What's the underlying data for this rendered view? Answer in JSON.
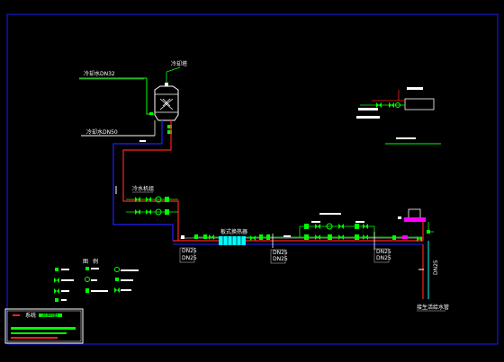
{
  "labels": {
    "top_left_pipe": "冷却水DN32",
    "mid_left_pipe": "冷却水DN50",
    "tower_top": "冷却塔",
    "valve_group": "冷水机组",
    "heat_exchanger": "板式换热器",
    "tag_a1": "DN25",
    "tag_a2": "DN25",
    "tag_b1": "DN25",
    "tag_b2": "DN25",
    "tag_c1": "DN25",
    "tag_c2": "DN25",
    "right_vertical": "DN25",
    "bottom_right": "接生活给水管",
    "legend_header_a": "图",
    "legend_header_b": "例",
    "title_main": "系统",
    "title_sub": "流程图"
  },
  "colors": {
    "background": "#000000",
    "frame": "#1a1aff",
    "white": "#ffffff",
    "green": "#00ff00",
    "red": "#ff2020",
    "blue": "#2020ff",
    "cyan": "#00ffff",
    "magenta": "#ff00ff",
    "yellow": "#ffff00"
  }
}
